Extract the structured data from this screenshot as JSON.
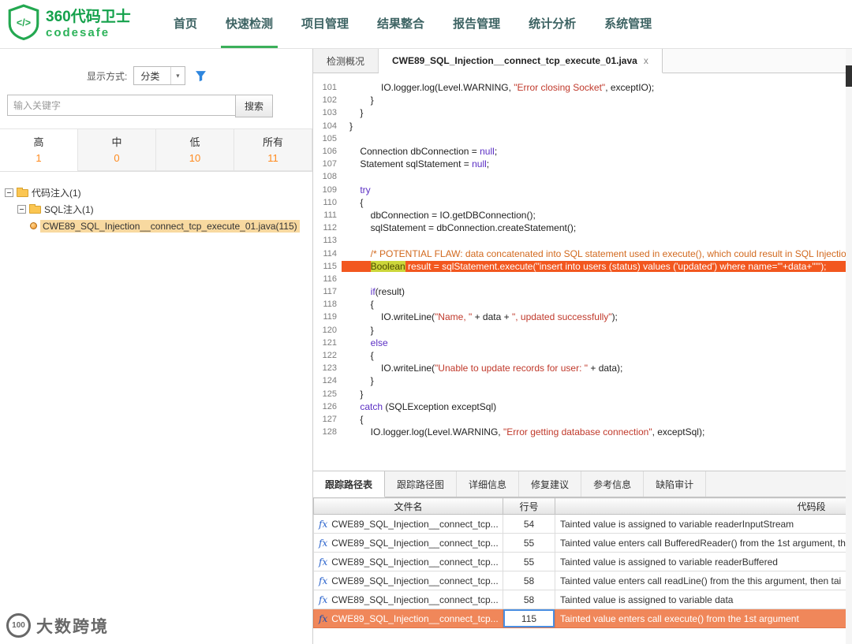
{
  "header": {
    "logo": {
      "title": "360代码卫士",
      "subtitle": "codesafe"
    },
    "nav": [
      {
        "label": "首页",
        "active": false
      },
      {
        "label": "快速检测",
        "active": true
      },
      {
        "label": "项目管理",
        "active": false
      },
      {
        "label": "结果整合",
        "active": false
      },
      {
        "label": "报告管理",
        "active": false
      },
      {
        "label": "统计分析",
        "active": false
      },
      {
        "label": "系统管理",
        "active": false
      }
    ]
  },
  "sidebar": {
    "display_mode": {
      "label": "显示方式:",
      "value": "分类"
    },
    "search": {
      "placeholder": "输入关键字",
      "button": "搜索"
    },
    "severity_tabs": [
      {
        "label": "高",
        "count": "1",
        "active": true
      },
      {
        "label": "中",
        "count": "0",
        "active": false
      },
      {
        "label": "低",
        "count": "10",
        "active": false
      },
      {
        "label": "所有",
        "count": "11",
        "active": false
      }
    ],
    "tree": [
      {
        "label": "代码注入(1)",
        "type": "folder",
        "indent": 0,
        "selected": false
      },
      {
        "label": "SQL注入(1)",
        "type": "folder",
        "indent": 1,
        "selected": false
      },
      {
        "label": "CWE89_SQL_Injection__connect_tcp_execute_01.java(115)",
        "type": "defect",
        "indent": 2,
        "selected": true
      }
    ]
  },
  "main": {
    "close_glyph": "x",
    "file_tabs": [
      {
        "label": "检测概况",
        "active": false,
        "closable": false
      },
      {
        "label": "CWE89_SQL_Injection__connect_tcp_execute_01.java",
        "active": true,
        "closable": true
      }
    ],
    "code_lines": [
      {
        "n": "101",
        "i": 3,
        "t": [
          [
            "p",
            "IO.logger.log(Level.WARNING, "
          ],
          [
            "s",
            "\"Error closing Socket\""
          ],
          [
            "p",
            ", exceptIO);"
          ]
        ]
      },
      {
        "n": "102",
        "i": 2,
        "t": [
          [
            "p",
            "}"
          ]
        ]
      },
      {
        "n": "103",
        "i": 1,
        "t": [
          [
            "p",
            "}"
          ]
        ]
      },
      {
        "n": "104",
        "i": 0,
        "t": [
          [
            "p",
            "}"
          ]
        ]
      },
      {
        "n": "105",
        "i": 0,
        "t": []
      },
      {
        "n": "106",
        "i": 1,
        "t": [
          [
            "p",
            "Connection dbConnection = "
          ],
          [
            "k",
            "null"
          ],
          [
            "p",
            ";"
          ]
        ]
      },
      {
        "n": "107",
        "i": 1,
        "t": [
          [
            "p",
            "Statement sqlStatement = "
          ],
          [
            "k",
            "null"
          ],
          [
            "p",
            ";"
          ]
        ]
      },
      {
        "n": "108",
        "i": 0,
        "t": []
      },
      {
        "n": "109",
        "i": 1,
        "t": [
          [
            "k",
            "try"
          ]
        ]
      },
      {
        "n": "110",
        "i": 1,
        "t": [
          [
            "p",
            "{"
          ]
        ]
      },
      {
        "n": "111",
        "i": 2,
        "t": [
          [
            "p",
            "dbConnection = IO.getDBConnection();"
          ]
        ]
      },
      {
        "n": "112",
        "i": 2,
        "t": [
          [
            "p",
            "sqlStatement = dbConnection.createStatement();"
          ]
        ]
      },
      {
        "n": "113",
        "i": 0,
        "t": []
      },
      {
        "n": "114",
        "i": 2,
        "t": [
          [
            "c",
            "/* POTENTIAL FLAW: data concatenated into SQL statement used in execute(), which could result in SQL Injection */"
          ]
        ]
      },
      {
        "n": "115",
        "i": 2,
        "hl": true,
        "t": [
          [
            "hlk",
            "Boolean"
          ],
          [
            "w",
            " result = sqlStatement.execute(\"insert into users (status) values ('updated') where name='\"+data+\"'\");"
          ]
        ]
      },
      {
        "n": "116",
        "i": 0,
        "t": []
      },
      {
        "n": "117",
        "i": 2,
        "t": [
          [
            "k",
            "if"
          ],
          [
            "p",
            "(result)"
          ]
        ]
      },
      {
        "n": "118",
        "i": 2,
        "t": [
          [
            "p",
            "{"
          ]
        ]
      },
      {
        "n": "119",
        "i": 3,
        "t": [
          [
            "p",
            "IO.writeLine("
          ],
          [
            "s",
            "\"Name, \""
          ],
          [
            "p",
            " + data + "
          ],
          [
            "s",
            "\", updated successfully\""
          ],
          [
            "p",
            ");"
          ]
        ]
      },
      {
        "n": "120",
        "i": 2,
        "t": [
          [
            "p",
            "}"
          ]
        ]
      },
      {
        "n": "121",
        "i": 2,
        "t": [
          [
            "k",
            "else"
          ]
        ]
      },
      {
        "n": "122",
        "i": 2,
        "t": [
          [
            "p",
            "{"
          ]
        ]
      },
      {
        "n": "123",
        "i": 3,
        "t": [
          [
            "p",
            "IO.writeLine("
          ],
          [
            "s",
            "\"Unable to update records for user: \""
          ],
          [
            "p",
            " + data);"
          ]
        ]
      },
      {
        "n": "124",
        "i": 2,
        "t": [
          [
            "p",
            "}"
          ]
        ]
      },
      {
        "n": "125",
        "i": 1,
        "t": [
          [
            "p",
            "}"
          ]
        ]
      },
      {
        "n": "126",
        "i": 1,
        "t": [
          [
            "k",
            "catch"
          ],
          [
            "p",
            " (SQLException exceptSql)"
          ]
        ]
      },
      {
        "n": "127",
        "i": 1,
        "t": [
          [
            "p",
            "{"
          ]
        ]
      },
      {
        "n": "128",
        "i": 2,
        "t": [
          [
            "p",
            "IO.logger.log(Level.WARNING, "
          ],
          [
            "s",
            "\"Error getting database connection\""
          ],
          [
            "p",
            ", exceptSql);"
          ]
        ]
      }
    ],
    "bottom_tabs": [
      {
        "label": "跟踪路径表",
        "active": true
      },
      {
        "label": "跟踪路径图",
        "active": false
      },
      {
        "label": "详细信息",
        "active": false
      },
      {
        "label": "修复建议",
        "active": false
      },
      {
        "label": "参考信息",
        "active": false
      },
      {
        "label": "缺陷审计",
        "active": false
      }
    ],
    "trace_table": {
      "fx_icon": "fx",
      "headers": [
        "文件名",
        "行号",
        "代码段"
      ],
      "rows": [
        {
          "file": "CWE89_SQL_Injection__connect_tcp...",
          "line": "54",
          "code": "Tainted value is assigned to variable readerInputStream",
          "highlight": false
        },
        {
          "file": "CWE89_SQL_Injection__connect_tcp...",
          "line": "55",
          "code": "Tainted value enters call BufferedReader() from the 1st argument, th",
          "highlight": false
        },
        {
          "file": "CWE89_SQL_Injection__connect_tcp...",
          "line": "55",
          "code": "Tainted value is assigned to variable readerBuffered",
          "highlight": false
        },
        {
          "file": "CWE89_SQL_Injection__connect_tcp...",
          "line": "58",
          "code": "Tainted value enters call readLine() from the this argument, then tai",
          "highlight": false
        },
        {
          "file": "CWE89_SQL_Injection__connect_tcp...",
          "line": "58",
          "code": "Tainted value is assigned to variable data",
          "highlight": false
        },
        {
          "file": "CWE89_SQL_Injection__connect_tcp...",
          "line": "115",
          "code": "Tainted value enters call execute() from the 1st argument",
          "highlight": true
        }
      ]
    }
  },
  "watermark": {
    "logo_text": "100",
    "text": "大数跨境"
  },
  "colors": {
    "accent_green": "#3bb05a",
    "severity_count_orange": "#ff8a1e",
    "code_highlight_orange": "#f2571f",
    "row_highlight_orange": "#f0875a",
    "tree_selected_tan": "#f8d9a0",
    "filter_icon_blue": "#2e86de"
  }
}
